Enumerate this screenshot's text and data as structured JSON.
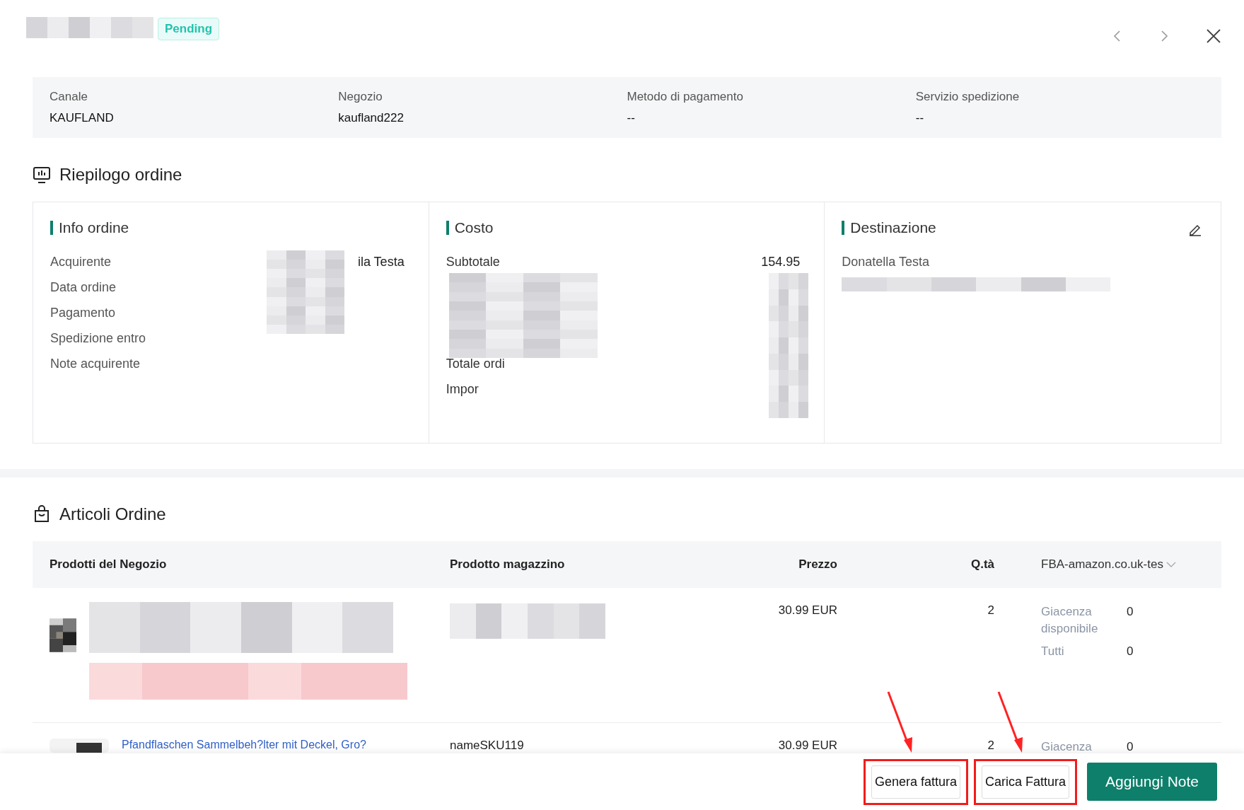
{
  "header": {
    "status": "Pending"
  },
  "info_bar": [
    {
      "label": "Canale",
      "value": "KAUFLAND"
    },
    {
      "label": "Negozio",
      "value": "kaufland222"
    },
    {
      "label": "Metodo di pagamento",
      "value": "--"
    },
    {
      "label": "Servizio spedizione",
      "value": "--"
    }
  ],
  "summary": {
    "title": "Riepilogo ordine",
    "info_ordine": {
      "title": "Info ordine",
      "rows": [
        {
          "label": "Acquirente",
          "value": "ila Testa"
        },
        {
          "label": "Data ordine"
        },
        {
          "label": "Pagamento"
        },
        {
          "label": "Spedizione entro"
        },
        {
          "label": "Note acquirente"
        }
      ]
    },
    "costo": {
      "title": "Costo",
      "rows": [
        {
          "label": "Subtotale",
          "value": "154.95"
        },
        {
          "label": "Totale ordi"
        },
        {
          "label": "Impor"
        }
      ]
    },
    "destinazione": {
      "title": "Destinazione",
      "name": "Donatella Testa"
    }
  },
  "items": {
    "title": "Articoli Ordine",
    "columns": [
      "Prodotti del Negozio",
      "Prodotto magazzino",
      "Prezzo",
      "Q.tà",
      "FBA-amazon.co.uk-tes"
    ],
    "rows": [
      {
        "product": "",
        "sku": "",
        "price": "30.99 EUR",
        "qty": "2",
        "stock": [
          {
            "label": "Giacenza disponibile",
            "value": "0"
          },
          {
            "label": "Tutti",
            "value": "0"
          }
        ]
      },
      {
        "product": "Pfandflaschen Sammelbeh?lter mit Deckel, Gro?",
        "sku": "nameSKU119",
        "price": "30.99 EUR",
        "qty": "2",
        "stock": [
          {
            "label": "Giacenza",
            "value": "0"
          }
        ]
      }
    ]
  },
  "footer": {
    "buttons": [
      {
        "label": "Genera fattura",
        "kind": "outline",
        "highlighted": true
      },
      {
        "label": "Carica Fattura",
        "kind": "outline",
        "highlighted": true
      },
      {
        "label": "Aggiungi Note",
        "kind": "primary",
        "highlighted": false
      }
    ]
  }
}
